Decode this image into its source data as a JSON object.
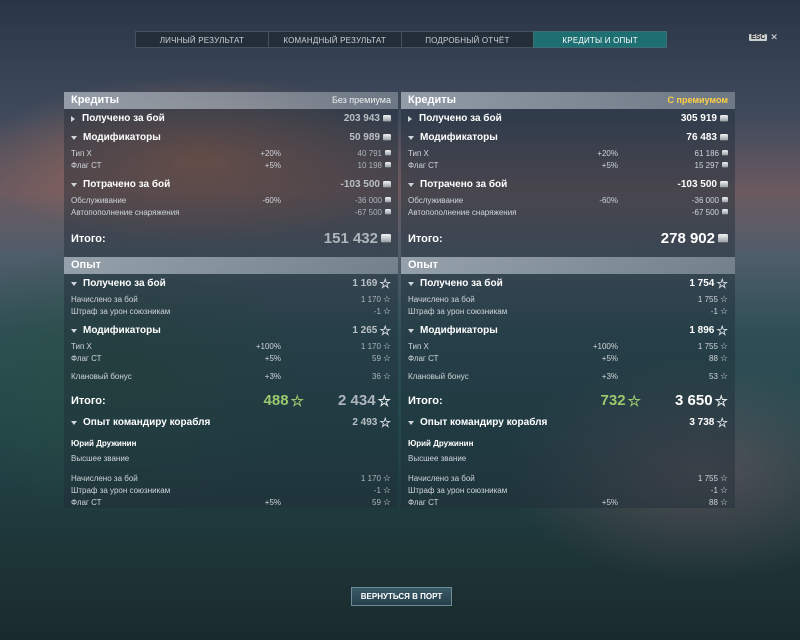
{
  "tabs": [
    "ЛИЧНЫЙ РЕЗУЛЬТАТ",
    "КОМАНДНЫЙ РЕЗУЛЬТАТ",
    "ПОДРОБНЫЙ ОТЧЁТ",
    "КРЕДИТЫ И ОПЫТ"
  ],
  "esc": "ESC",
  "return_button": "ВЕРНУТЬСЯ В ПОРТ",
  "left": {
    "credits_title": "Кредиты",
    "credits_sub": "Без премиума",
    "earned_label": "Получено за бой",
    "earned": "203 943",
    "mod_label": "Модификаторы",
    "mod": "50 989",
    "type_x": "Тип X",
    "type_x_pct": "+20%",
    "type_x_val": "40 791",
    "flag": "Флаг СТ",
    "flag_pct": "+5%",
    "flag_val": "10 198",
    "spent_label": "Потрачено за бой",
    "spent": "-103 500",
    "service": "Обслуживание",
    "service_pct": "-60%",
    "service_val": "-36 000",
    "supply": "Автопополнение снаряжения",
    "supply_val": "-67 500",
    "total_label": "Итого:",
    "total": "151 432",
    "exp_title": "Опыт",
    "exp_earned_label": "Получено за бой",
    "exp_earned": "1 169",
    "accrued": "Начислено за бой",
    "accrued_val": "1 170",
    "penalty": "Штраф за урон союзникам",
    "penalty_val": "-1",
    "exp_mod_label": "Модификаторы",
    "exp_mod": "1 265",
    "e_type_x": "Тип X",
    "e_type_x_pct": "+100%",
    "e_type_x_val": "1 170",
    "e_flag": "Флаг СТ",
    "e_flag_pct": "+5%",
    "e_flag_val": "59",
    "clan": "Клановый бонус",
    "clan_pct": "+3%",
    "clan_val": "36",
    "exp_total_label": "Итого:",
    "exp_free": "488",
    "exp_total": "2 434",
    "cmdr_label": "Опыт командиру корабля",
    "cmdr": "2 493",
    "cmdr_name": "Юрий Дружинин",
    "cmdr_rank": "Высшее звание",
    "c_accrued": "Начислено за бой",
    "c_accrued_val": "1 170",
    "c_penalty": "Штраф за урон союзникам",
    "c_penalty_val": "-1",
    "c_flag": "Флаг СТ",
    "c_flag_pct": "+5%",
    "c_flag_val": "59"
  },
  "right": {
    "credits_title": "Кредиты",
    "credits_sub": "С премиумом",
    "earned_label": "Получено за бой",
    "earned": "305 919",
    "mod_label": "Модификаторы",
    "mod": "76 483",
    "type_x": "Тип X",
    "type_x_pct": "+20%",
    "type_x_val": "61 186",
    "flag": "Флаг СТ",
    "flag_pct": "+5%",
    "flag_val": "15 297",
    "spent_label": "Потрачено за бой",
    "spent": "-103 500",
    "service": "Обслуживание",
    "service_pct": "-60%",
    "service_val": "-36 000",
    "supply": "Автопополнение снаряжения",
    "supply_val": "-67 500",
    "total_label": "Итого:",
    "total": "278 902",
    "exp_title": "Опыт",
    "exp_earned_label": "Получено за бой",
    "exp_earned": "1 754",
    "accrued": "Начислено за бой",
    "accrued_val": "1 755",
    "penalty": "Штраф за урон союзникам",
    "penalty_val": "-1",
    "exp_mod_label": "Модификаторы",
    "exp_mod": "1 896",
    "e_type_x": "Тип X",
    "e_type_x_pct": "+100%",
    "e_type_x_val": "1 755",
    "e_flag": "Флаг СТ",
    "e_flag_pct": "+5%",
    "e_flag_val": "88",
    "clan": "Клановый бонус",
    "clan_pct": "+3%",
    "clan_val": "53",
    "exp_total_label": "Итого:",
    "exp_free": "732",
    "exp_total": "3 650",
    "cmdr_label": "Опыт командиру корабля",
    "cmdr": "3 738",
    "cmdr_name": "Юрий Дружинин",
    "cmdr_rank": "Высшее звание",
    "c_accrued": "Начислено за бой",
    "c_accrued_val": "1 755",
    "c_penalty": "Штраф за урон союзникам",
    "c_penalty_val": "-1",
    "c_flag": "Флаг СТ",
    "c_flag_pct": "+5%",
    "c_flag_val": "88"
  },
  "icons": {
    "credit": "credit-coin-icon",
    "xp": "star-icon",
    "free_xp": "free-xp-star-icon"
  },
  "colors": {
    "active_tab": "#1d6f72",
    "premium": "#ffcf45",
    "free_xp": "#9ac86e"
  }
}
